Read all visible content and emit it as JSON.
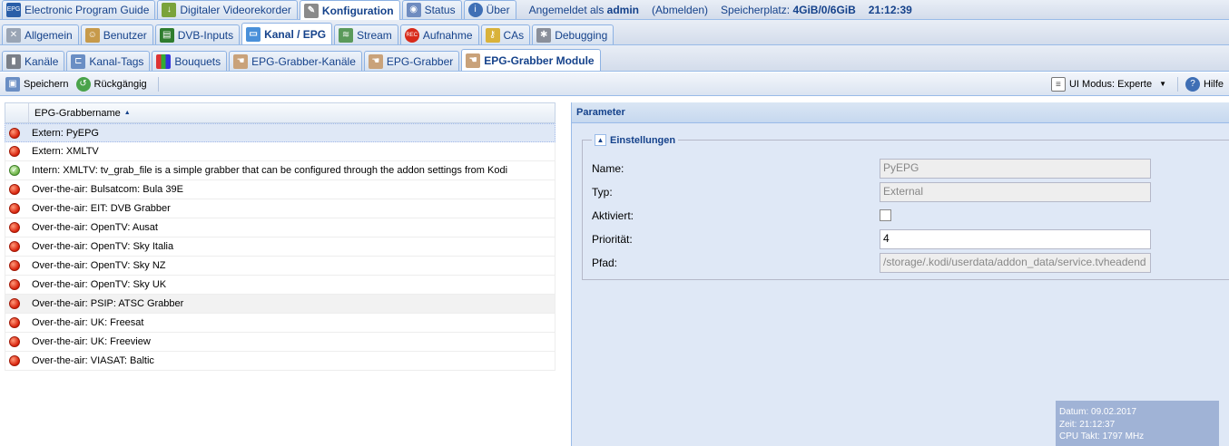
{
  "top_tabs": [
    {
      "label": "Electronic Program Guide",
      "icon": "epg-icon"
    },
    {
      "label": "Digitaler Videorekorder",
      "icon": "download-icon"
    },
    {
      "label": "Konfiguration",
      "icon": "wrench-icon"
    },
    {
      "label": "Status",
      "icon": "eye-icon"
    },
    {
      "label": "Über",
      "icon": "info-icon"
    }
  ],
  "status": {
    "logged_in_prefix": "Angemeldet als",
    "user": "admin",
    "logout": "(Abmelden)",
    "storage_label": "Speicherplatz:",
    "storage_value": "4GiB/0/6GiB",
    "clock": "21:12:39"
  },
  "config_tabs": [
    {
      "label": "Allgemein",
      "icon": "tools-icon"
    },
    {
      "label": "Benutzer",
      "icon": "users-icon"
    },
    {
      "label": "DVB-Inputs",
      "icon": "card-icon"
    },
    {
      "label": "Kanal / EPG",
      "icon": "tv-icon"
    },
    {
      "label": "Stream",
      "icon": "stream-icon"
    },
    {
      "label": "Aufnahme",
      "icon": "record-icon"
    },
    {
      "label": "CAs",
      "icon": "key-icon"
    },
    {
      "label": "Debugging",
      "icon": "bug-icon"
    }
  ],
  "sub_tabs": [
    {
      "label": "Kanäle",
      "icon": "remote-icon"
    },
    {
      "label": "Kanal-Tags",
      "icon": "tags-icon"
    },
    {
      "label": "Bouquets",
      "icon": "grid-icon"
    },
    {
      "label": "EPG-Grabber-Kanäle",
      "icon": "grabber-icon"
    },
    {
      "label": "EPG-Grabber",
      "icon": "grabber-icon"
    },
    {
      "label": "EPG-Grabber Module",
      "icon": "grabber-icon"
    }
  ],
  "toolbar": {
    "save": "Speichern",
    "undo": "Rückgängig",
    "ui_mode": "UI Modus: Experte",
    "help": "Hilfe"
  },
  "grid": {
    "column": "EPG-Grabbername",
    "rows": [
      {
        "name": "Extern: PyEPG",
        "enabled": false
      },
      {
        "name": "Extern: XMLTV",
        "enabled": false
      },
      {
        "name": "Intern: XMLTV: tv_grab_file is a simple grabber that can be configured through the addon settings from Kodi",
        "enabled": true
      },
      {
        "name": "Over-the-air: Bulsatcom: Bula 39E",
        "enabled": false
      },
      {
        "name": "Over-the-air: EIT: DVB Grabber",
        "enabled": false
      },
      {
        "name": "Over-the-air: OpenTV: Ausat",
        "enabled": false
      },
      {
        "name": "Over-the-air: OpenTV: Sky Italia",
        "enabled": false
      },
      {
        "name": "Over-the-air: OpenTV: Sky NZ",
        "enabled": false
      },
      {
        "name": "Over-the-air: OpenTV: Sky UK",
        "enabled": false
      },
      {
        "name": "Over-the-air: PSIP: ATSC Grabber",
        "enabled": false
      },
      {
        "name": "Over-the-air: UK: Freesat",
        "enabled": false
      },
      {
        "name": "Over-the-air: UK: Freeview",
        "enabled": false
      },
      {
        "name": "Over-the-air: VIASAT: Baltic",
        "enabled": false
      }
    ]
  },
  "panel": {
    "title": "Parameter",
    "fieldset": "Einstellungen",
    "name_label": "Name:",
    "name_value": "PyEPG",
    "type_label": "Typ:",
    "type_value": "External",
    "enabled_label": "Aktiviert:",
    "priority_label": "Priorität:",
    "priority_value": "4",
    "path_label": "Pfad:",
    "path_value": "/storage/.kodi/userdata/addon_data/service.tvheadend"
  },
  "info": {
    "date": "Datum: 09.02.2017",
    "time": "Zeit: 21:12:37",
    "cpu": "CPU Takt: 1797 MHz"
  }
}
